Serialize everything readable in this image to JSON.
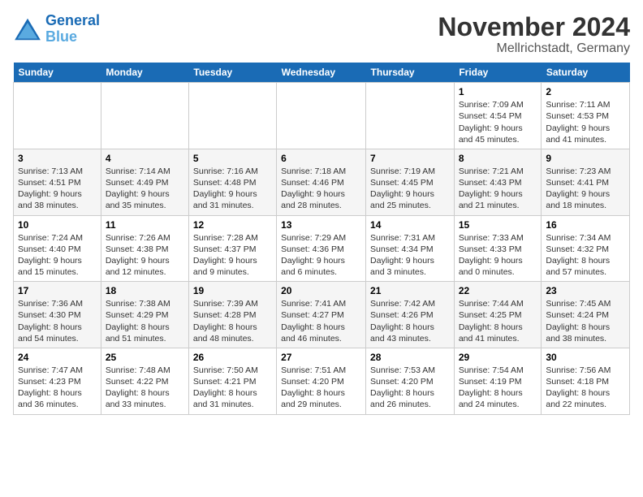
{
  "logo": {
    "line1": "General",
    "line2": "Blue"
  },
  "title": "November 2024",
  "subtitle": "Mellrichstadt, Germany",
  "days_of_week": [
    "Sunday",
    "Monday",
    "Tuesday",
    "Wednesday",
    "Thursday",
    "Friday",
    "Saturday"
  ],
  "weeks": [
    [
      {
        "day": "",
        "detail": ""
      },
      {
        "day": "",
        "detail": ""
      },
      {
        "day": "",
        "detail": ""
      },
      {
        "day": "",
        "detail": ""
      },
      {
        "day": "",
        "detail": ""
      },
      {
        "day": "1",
        "detail": "Sunrise: 7:09 AM\nSunset: 4:54 PM\nDaylight: 9 hours and 45 minutes."
      },
      {
        "day": "2",
        "detail": "Sunrise: 7:11 AM\nSunset: 4:53 PM\nDaylight: 9 hours and 41 minutes."
      }
    ],
    [
      {
        "day": "3",
        "detail": "Sunrise: 7:13 AM\nSunset: 4:51 PM\nDaylight: 9 hours and 38 minutes."
      },
      {
        "day": "4",
        "detail": "Sunrise: 7:14 AM\nSunset: 4:49 PM\nDaylight: 9 hours and 35 minutes."
      },
      {
        "day": "5",
        "detail": "Sunrise: 7:16 AM\nSunset: 4:48 PM\nDaylight: 9 hours and 31 minutes."
      },
      {
        "day": "6",
        "detail": "Sunrise: 7:18 AM\nSunset: 4:46 PM\nDaylight: 9 hours and 28 minutes."
      },
      {
        "day": "7",
        "detail": "Sunrise: 7:19 AM\nSunset: 4:45 PM\nDaylight: 9 hours and 25 minutes."
      },
      {
        "day": "8",
        "detail": "Sunrise: 7:21 AM\nSunset: 4:43 PM\nDaylight: 9 hours and 21 minutes."
      },
      {
        "day": "9",
        "detail": "Sunrise: 7:23 AM\nSunset: 4:41 PM\nDaylight: 9 hours and 18 minutes."
      }
    ],
    [
      {
        "day": "10",
        "detail": "Sunrise: 7:24 AM\nSunset: 4:40 PM\nDaylight: 9 hours and 15 minutes."
      },
      {
        "day": "11",
        "detail": "Sunrise: 7:26 AM\nSunset: 4:38 PM\nDaylight: 9 hours and 12 minutes."
      },
      {
        "day": "12",
        "detail": "Sunrise: 7:28 AM\nSunset: 4:37 PM\nDaylight: 9 hours and 9 minutes."
      },
      {
        "day": "13",
        "detail": "Sunrise: 7:29 AM\nSunset: 4:36 PM\nDaylight: 9 hours and 6 minutes."
      },
      {
        "day": "14",
        "detail": "Sunrise: 7:31 AM\nSunset: 4:34 PM\nDaylight: 9 hours and 3 minutes."
      },
      {
        "day": "15",
        "detail": "Sunrise: 7:33 AM\nSunset: 4:33 PM\nDaylight: 9 hours and 0 minutes."
      },
      {
        "day": "16",
        "detail": "Sunrise: 7:34 AM\nSunset: 4:32 PM\nDaylight: 8 hours and 57 minutes."
      }
    ],
    [
      {
        "day": "17",
        "detail": "Sunrise: 7:36 AM\nSunset: 4:30 PM\nDaylight: 8 hours and 54 minutes."
      },
      {
        "day": "18",
        "detail": "Sunrise: 7:38 AM\nSunset: 4:29 PM\nDaylight: 8 hours and 51 minutes."
      },
      {
        "day": "19",
        "detail": "Sunrise: 7:39 AM\nSunset: 4:28 PM\nDaylight: 8 hours and 48 minutes."
      },
      {
        "day": "20",
        "detail": "Sunrise: 7:41 AM\nSunset: 4:27 PM\nDaylight: 8 hours and 46 minutes."
      },
      {
        "day": "21",
        "detail": "Sunrise: 7:42 AM\nSunset: 4:26 PM\nDaylight: 8 hours and 43 minutes."
      },
      {
        "day": "22",
        "detail": "Sunrise: 7:44 AM\nSunset: 4:25 PM\nDaylight: 8 hours and 41 minutes."
      },
      {
        "day": "23",
        "detail": "Sunrise: 7:45 AM\nSunset: 4:24 PM\nDaylight: 8 hours and 38 minutes."
      }
    ],
    [
      {
        "day": "24",
        "detail": "Sunrise: 7:47 AM\nSunset: 4:23 PM\nDaylight: 8 hours and 36 minutes."
      },
      {
        "day": "25",
        "detail": "Sunrise: 7:48 AM\nSunset: 4:22 PM\nDaylight: 8 hours and 33 minutes."
      },
      {
        "day": "26",
        "detail": "Sunrise: 7:50 AM\nSunset: 4:21 PM\nDaylight: 8 hours and 31 minutes."
      },
      {
        "day": "27",
        "detail": "Sunrise: 7:51 AM\nSunset: 4:20 PM\nDaylight: 8 hours and 29 minutes."
      },
      {
        "day": "28",
        "detail": "Sunrise: 7:53 AM\nSunset: 4:20 PM\nDaylight: 8 hours and 26 minutes."
      },
      {
        "day": "29",
        "detail": "Sunrise: 7:54 AM\nSunset: 4:19 PM\nDaylight: 8 hours and 24 minutes."
      },
      {
        "day": "30",
        "detail": "Sunrise: 7:56 AM\nSunset: 4:18 PM\nDaylight: 8 hours and 22 minutes."
      }
    ]
  ]
}
